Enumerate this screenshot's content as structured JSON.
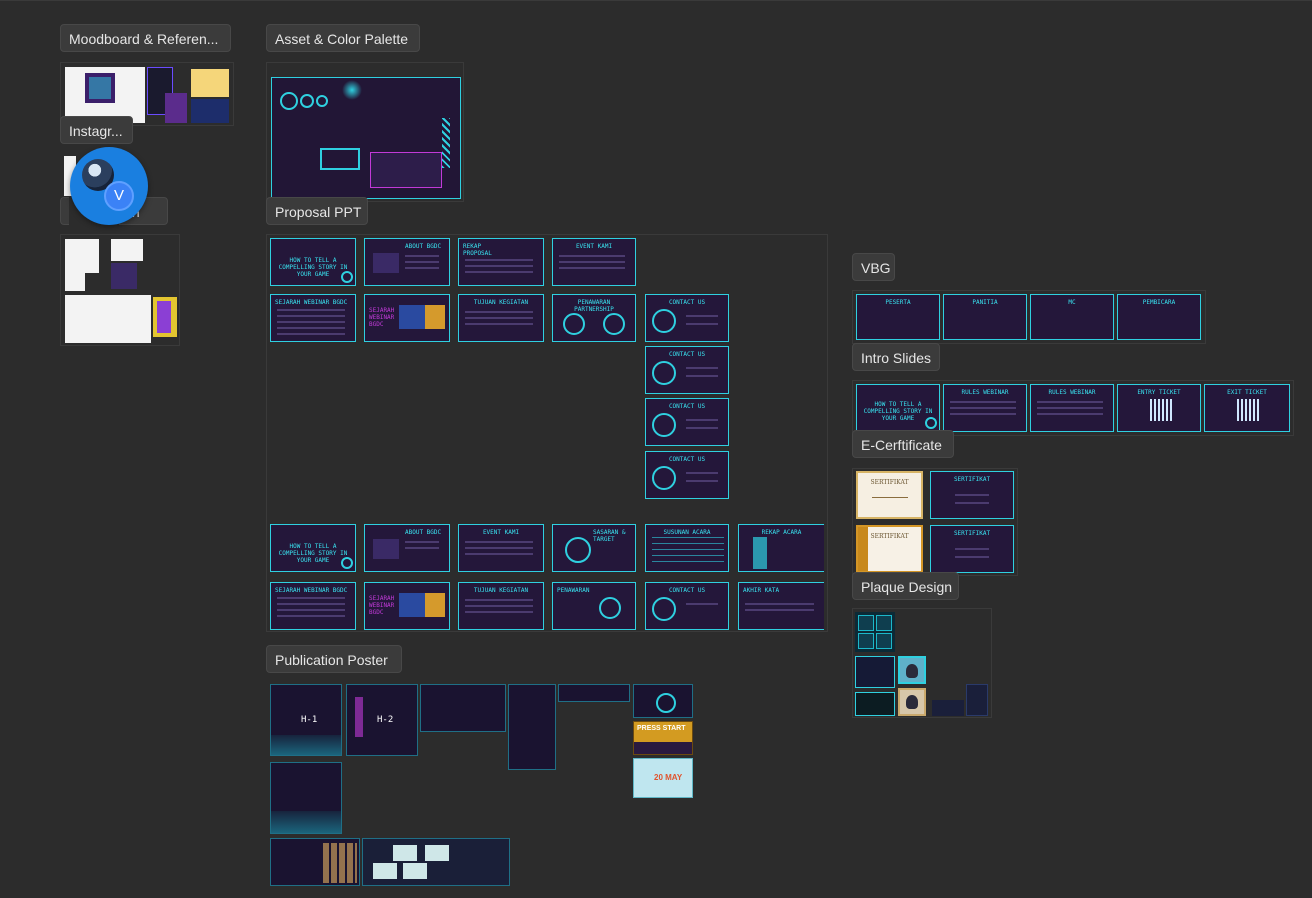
{
  "sections": {
    "moodboard": "Moodboard & Referen...",
    "instagram": "Instagr...",
    "ppt_sketch_left": "P",
    "ppt_sketch_right": "tch",
    "asset_palette": "Asset & Color Palette",
    "proposal": "Proposal PPT",
    "publication": "Publication Poster",
    "vbg": "VBG",
    "intro": "Intro Slides",
    "ecert": "E-Cerftificate",
    "plaque": "Plaque Design"
  },
  "user": {
    "initial": "V"
  },
  "proposal_slides": {
    "r1": [
      "HOW TO TELL A COMPELLING STORY IN YOUR GAME",
      "ABOUT BGDC",
      "REKAP PROPOSAL",
      "EVENT KAMI"
    ],
    "r2": [
      "SEJARAH WEBINAR BGDC",
      "SEJARAH WEBINAR BGDC",
      "TUJUAN KEGIATAN",
      "PENAWARAN PARTNERSHIP",
      "CONTACT US"
    ],
    "col": [
      "CONTACT US",
      "CONTACT US",
      "CONTACT US"
    ],
    "r3": [
      "HOW TO TELL A COMPELLING STORY IN YOUR GAME",
      "ABOUT BGDC",
      "EVENT KAMI",
      "SASARAN & TARGET",
      "SUSUNAN ACARA",
      "REKAP ACARA"
    ],
    "r4": [
      "SEJARAH WEBINAR BGDC",
      "SEJARAH WEBINAR BGDC",
      "TUJUAN KEGIATAN",
      "PENAWARAN",
      "CONTACT US",
      "AKHIR KATA"
    ]
  },
  "vbg_slides": [
    "PESERTA",
    "PANITIA",
    "MC",
    "PEMBICARA"
  ],
  "intro_slides": [
    "HOW TO TELL A COMPELLING STORY IN YOUR GAME",
    "RULES WEBINAR",
    "RULES WEBINAR",
    "ENTRY TICKET",
    "EXIT TICKET"
  ],
  "certificates": {
    "a_title": "SERTIFIKAT",
    "b_title": "SERTIFIKAT",
    "c_title": "SERTIFIKAT",
    "d_title": "SERTIFIKAT"
  },
  "posters": {
    "h1": "H-1",
    "h2": "H-2",
    "press": "PRESS START",
    "day": "20 MAY"
  },
  "colors": {
    "canvas": "#2c2c2c",
    "cyan": "#2fd0e0",
    "purple": "#24173a",
    "magenta": "#c13ad8",
    "avatar": "#1a7fe0"
  }
}
